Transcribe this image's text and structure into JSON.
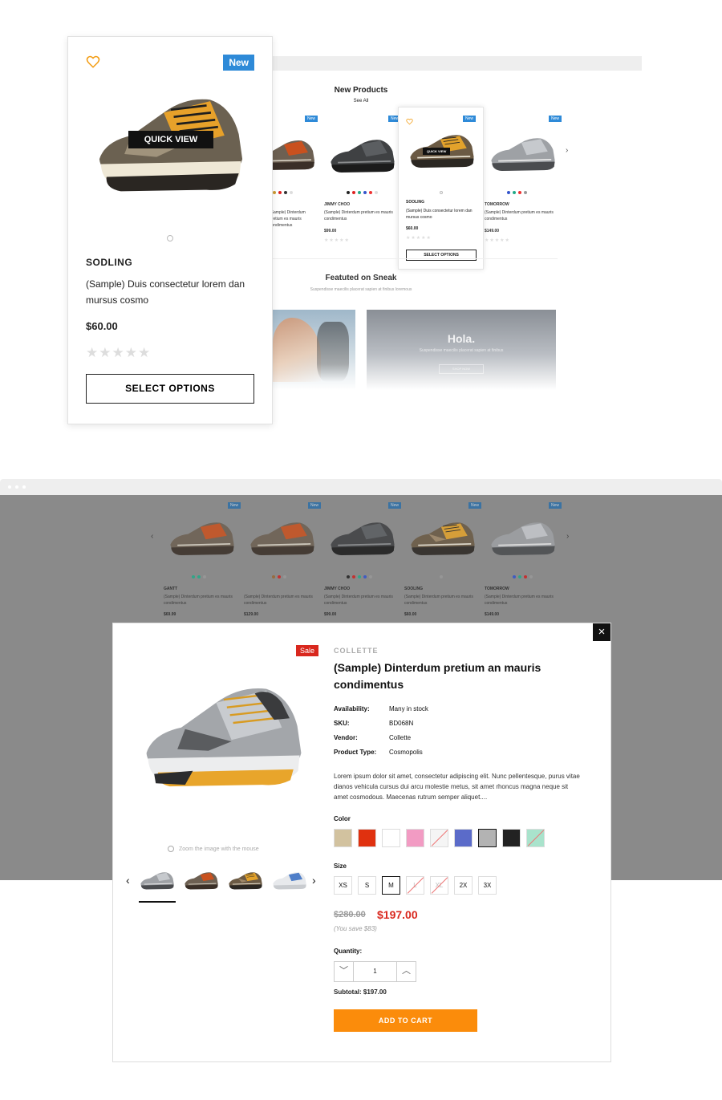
{
  "preview": {
    "section_title": "New Products",
    "see_all": "See All",
    "cards": [
      {
        "name": "",
        "desc": "(Sample) Dinterdum pretium es mauris condimentus",
        "price": "",
        "badge": "New"
      },
      {
        "name": "JIMMY CHOO",
        "desc": "(Sample) Dinterdum pretium es mauris condimentus",
        "price": "$99.00",
        "badge": "New"
      },
      {
        "name": "SOOLING",
        "desc": "(Sample) Duis consectetur lorem dan mursus cosmo",
        "price": "$60.00",
        "badge": "New",
        "quick_view": "QUICK VIEW",
        "select": "SELECT OPTIONS"
      },
      {
        "name": "TOMORROW",
        "desc": "(Sample) Dinterdum pretium es mauris condimentus",
        "price": "$149.00",
        "badge": "New"
      }
    ],
    "featured_title": "Featuted on Sneak",
    "featured_sub": "Suspendisse maecilis placerat sapien at finibus loremous",
    "banner_title": "Hola.",
    "banner_sub": "Suspendisse maecilis placerat sapien at finibus",
    "banner_button": "SHOP NOW",
    "stars": "★★★★★"
  },
  "big_card": {
    "badge": "New",
    "quick_view": "QUICK VIEW",
    "name": "SODLING",
    "desc": "(Sample) Duis consectetur lorem dan mursus cosmo",
    "price": "$60.00",
    "stars": "★★★★★",
    "select_label": "SELECT OPTIONS"
  },
  "grid": {
    "cards": [
      {
        "name": "GANTT",
        "desc": "(Sample) Dinterdum pretium es mauris condimentus",
        "price": "$69.99",
        "badge": "New"
      },
      {
        "name": "",
        "desc": "(Sample) Dinterdum pretium es mauris condimentus",
        "price": "$129.00",
        "badge": "New"
      },
      {
        "name": "JIMMY CHOO",
        "desc": "(Sample) Dinterdum pretium es mauris condimentus",
        "price": "$99.00",
        "badge": "New"
      },
      {
        "name": "SOOLING",
        "desc": "(Sample) Dinterdum pretium es mauris condimentus",
        "price": "$60.00",
        "badge": "New"
      },
      {
        "name": "TOMORROW",
        "desc": "(Sample) Dinterdum pretium es mauris condimentus",
        "price": "$149.00",
        "badge": "New"
      }
    ]
  },
  "modal": {
    "sale": "Sale",
    "vendor_label": "COLLETTE",
    "title": "(Sample) Dinterdum pretium an mauris condimentus",
    "info": [
      {
        "k": "Availability:",
        "v": "Many in stock"
      },
      {
        "k": "SKU:",
        "v": "BD068N"
      },
      {
        "k": "Vendor:",
        "v": "Collette"
      },
      {
        "k": "Product Type:",
        "v": "Cosmopolis"
      }
    ],
    "description": "Lorem ipsum dolor sit amet, consectetur adipiscing elit. Nunc pellentesque, purus vitae dianos vehicula cursus dui arcu molestie metus, sit amet rhoncus magna neque sit amet cosmodous. Maecenas rutrum semper aliquet....",
    "zoom_hint": "Zoom the image with the mouse",
    "color_label": "Color",
    "colors": [
      "#d2c29f",
      "#e0310f",
      "#ffffff",
      "#f29bc3",
      "#f5f5f5",
      "#5b6bc9",
      "#b3b3b3",
      "#222222",
      "#a9e3cc"
    ],
    "size_label": "Size",
    "sizes": [
      "XS",
      "S",
      "M",
      "L",
      "XL",
      "2X",
      "3X"
    ],
    "old_price": "$280.00",
    "new_price": "$197.00",
    "you_save": "(You save $83)",
    "quantity_label": "Quantity:",
    "quantity": "1",
    "minus": "﹀",
    "plus": "︿",
    "subtotal": "Subtotal: $197.00",
    "add_to_cart": "ADD TO CART",
    "close": "×",
    "prev": "‹",
    "next": "›"
  },
  "colors": {
    "badge_blue": "#2e8ad8",
    "sale_red": "#d9281e",
    "cart_orange": "#fb8c0b",
    "heart_orange": "#f39c12"
  }
}
